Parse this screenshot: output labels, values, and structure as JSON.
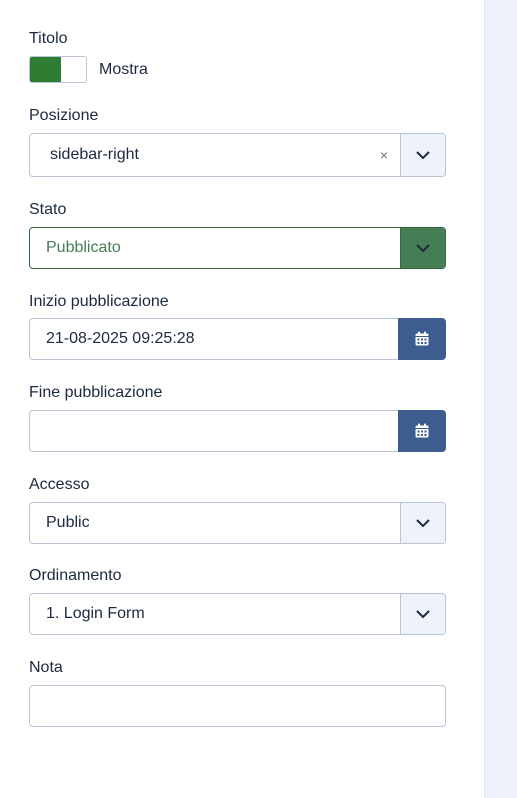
{
  "title_field": {
    "label": "Titolo",
    "toggle_label": "Mostra",
    "toggle_on": true
  },
  "position_field": {
    "label": "Posizione",
    "value": "sidebar-right",
    "clear_symbol": "×"
  },
  "state_field": {
    "label": "Stato",
    "value": "Pubblicato"
  },
  "publish_up": {
    "label": "Inizio pubblicazione",
    "value": "21-08-2025 09:25:28"
  },
  "publish_down": {
    "label": "Fine pubblicazione",
    "value": ""
  },
  "access_field": {
    "label": "Accesso",
    "value": "Public"
  },
  "ordering_field": {
    "label": "Ordinamento",
    "value": "1. Login Form"
  },
  "note_field": {
    "label": "Nota",
    "value": ""
  },
  "colors": {
    "toggle_on": "#2e7d32",
    "state_accent": "#457d54",
    "calendar_button": "#3d5c8f",
    "addon_bg": "#eef2fa"
  },
  "icons": {
    "chevron": "chevron-down-icon",
    "calendar": "calendar-icon",
    "clear": "clear-icon"
  }
}
